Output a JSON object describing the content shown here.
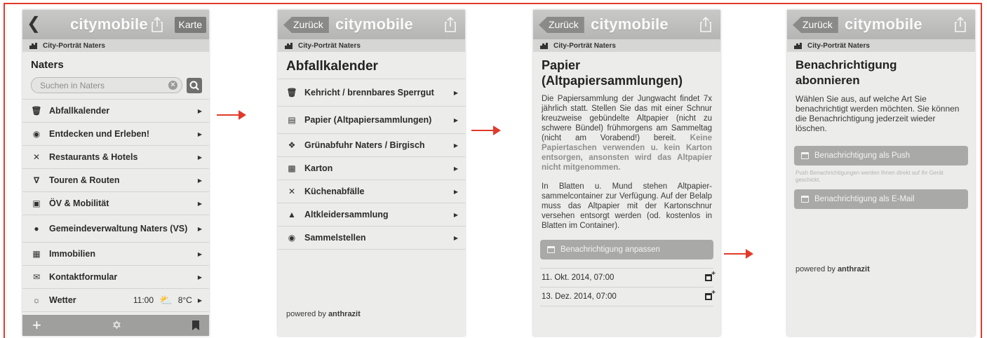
{
  "brand": "citymobile",
  "breadcrumb": "City-Porträt Naters",
  "colors": {
    "frame": "#e23a2a",
    "topbar": "#bdbdbb",
    "button_grey": "#a9a9a7"
  },
  "screen1": {
    "karte_label": "Karte",
    "title": "Naters",
    "search_placeholder": "Suchen in Naters",
    "items": [
      {
        "icon": "trash-icon",
        "label": "Abfallkalender"
      },
      {
        "icon": "eye-icon",
        "label": "Entdecken und Erleben!"
      },
      {
        "icon": "cutlery-icon",
        "label": "Restaurants & Hotels"
      },
      {
        "icon": "signpost-icon",
        "label": "Touren & Routen"
      },
      {
        "icon": "bus-icon",
        "label": "ÖV & Mobilität"
      },
      {
        "icon": "location-pin-icon",
        "label": "Gemeindeverwaltung Naters (VS)"
      },
      {
        "icon": "buildings-icon",
        "label": "Immobilien"
      },
      {
        "icon": "envelope-icon",
        "label": "Kontaktformular"
      },
      {
        "icon": "sun-icon",
        "label": "Wetter"
      }
    ],
    "weather": {
      "time": "11:00",
      "temp": "8°C"
    }
  },
  "screen2": {
    "back_label": "Zurück",
    "title": "Abfallkalender",
    "items": [
      {
        "icon": "trash-icon",
        "label": "Kehricht / brennbares Sperrgut"
      },
      {
        "icon": "newspaper-icon",
        "label": "Papier (Altpapiersammlungen)"
      },
      {
        "icon": "leaf-icon",
        "label": "Grünabfuhr Naters / Birgisch"
      },
      {
        "icon": "box-icon",
        "label": "Karton"
      },
      {
        "icon": "cutlery-icon",
        "label": "Küchenabfälle"
      },
      {
        "icon": "shirt-icon",
        "label": "Altkleidersammlung"
      },
      {
        "icon": "target-icon",
        "label": "Sammelstellen"
      }
    ],
    "powered_prefix": "powered by ",
    "powered_brand": "anthrazit"
  },
  "screen3": {
    "back_label": "Zurück",
    "title": "Papier (Altpapiersammlungen)",
    "para1": "Die Papiersammlung der Jungwacht findet 7x jährlich statt. Stellen Sie das mit einer Schnur kreuzweise gebündelte Altpapier (nicht zu schwere Bündel) frühmorgens am Sammeltag (nicht am Vorabend!) bereit.",
    "para1_bold": "Keine Papiertaschen verwenden u. kein Karton entsorgen, ansonsten wird das Altpapier nicht mitgenommen.",
    "para2": "In Blatten u. Mund stehen Altpapier-sammelcontainer zur Verfügung. Auf der Belalp muss das Altpapier mit der Kartonschnur versehen entsorgt werden (od. kostenlos in Blatten im Container).",
    "button_label": "Benachrichtigung anpassen",
    "dates": [
      "11. Okt. 2014, 07:00",
      "13. Dez. 2014, 07:00"
    ]
  },
  "screen4": {
    "back_label": "Zurück",
    "title": "Benachrichtigung abonnieren",
    "intro": "Wählen Sie aus, auf welche Art Sie benachrichtigt werden möchten. Sie können die Benachrichtigung jederzeit wieder löschen.",
    "push_label": "Benachrichtigung als Push",
    "push_note": "Push Benachrichtigungen werden Ihnen direkt auf Ihr Gerät geschickt.",
    "email_label": "Benachrichtigung als E-Mail",
    "powered_prefix": "powered by ",
    "powered_brand": "anthrazit"
  }
}
